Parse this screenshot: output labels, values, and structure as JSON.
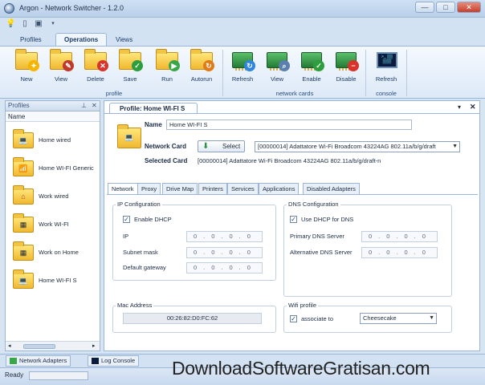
{
  "window": {
    "title": "Argon - Network Switcher - 1.2.0"
  },
  "ribbon_tabs": [
    "Profiles",
    "Operations",
    "Views"
  ],
  "ribbon": {
    "profile_group": {
      "label": "profile",
      "buttons": [
        "New",
        "View",
        "Delete",
        "Save",
        "Run",
        "Autorun"
      ]
    },
    "network_cards_group": {
      "label": "network cards",
      "buttons": [
        "Refresh",
        "View",
        "Enable",
        "Disable"
      ]
    },
    "console_group": {
      "label": "console",
      "buttons": [
        "Refresh"
      ]
    }
  },
  "profiles_panel": {
    "title": "Profiles",
    "column": "Name",
    "items": [
      {
        "label": "Home wired",
        "icon": "laptop-icon"
      },
      {
        "label": "Home WI-FI Generic",
        "icon": "wifi-icon"
      },
      {
        "label": "Work wired",
        "icon": "house-icon"
      },
      {
        "label": "Work WI-FI",
        "icon": "building-icon"
      },
      {
        "label": "Work on Home",
        "icon": "building-icon"
      },
      {
        "label": "Home WI-FI S",
        "icon": "laptop-icon"
      }
    ]
  },
  "profile": {
    "tab_title": "Profile: Home WI-FI S",
    "name_label": "Name",
    "name_value": "Home WI-FI S",
    "network_card_label": "Network Card",
    "select_button": "Select",
    "network_card_value": "[00000014] Adattatore Wi-Fi Broadcom 43224AG 802.11a/b/g/draft",
    "selected_card_label": "Selected Card",
    "selected_card_value": "[00000014] Adattatore Wi-Fi Broadcom 43224AG 802.11a/b/g/draft-n"
  },
  "settings_tabs": [
    "Network",
    "Proxy",
    "Drive Map",
    "Printers",
    "Services",
    "Applications",
    "Disabled Adapters"
  ],
  "network": {
    "ip_config": {
      "title": "IP Configuration",
      "enable_dhcp": "Enable DHCP",
      "ip_label": "IP",
      "subnet_label": "Subnet mask",
      "gateway_label": "Default gateway",
      "empty_ip": "0.0.0.0"
    },
    "dns_config": {
      "title": "DNS Configuration",
      "use_dhcp_dns": "Use DHCP for DNS",
      "primary_label": "Primary DNS Server",
      "alternative_label": "Alternative DNS Server",
      "empty_ip": "0.0.0.0"
    },
    "mac": {
      "title": "Mac Address",
      "value": "00:26:82:D0:FC:62"
    },
    "wifi": {
      "title": "Wifi profile",
      "associate_label": "associate to",
      "value": "Cheesecake"
    }
  },
  "bottom_tabs": [
    "Network Adapters",
    "Log Console"
  ],
  "status": {
    "text": "Ready"
  },
  "watermark": "DownloadSoftwareGratisan.com"
}
